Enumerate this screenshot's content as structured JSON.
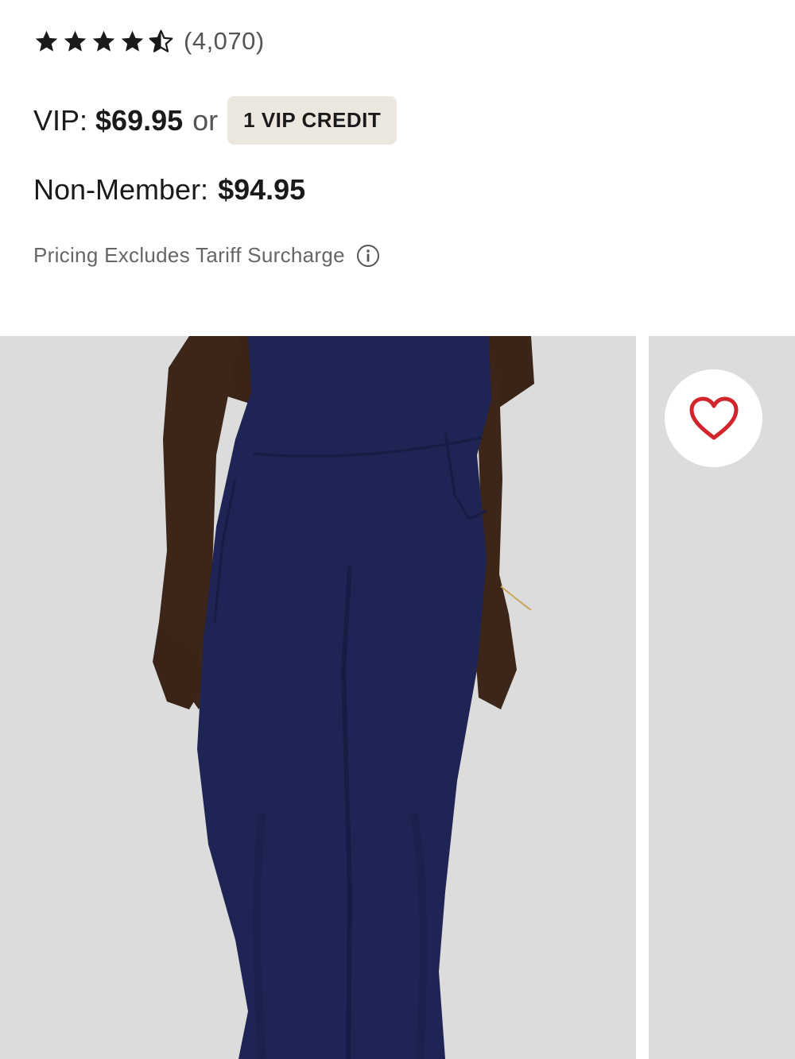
{
  "rating": {
    "stars_value": 4.5,
    "stars_max": 5,
    "review_count": "(4,070)",
    "star_color": "#1a1a1a"
  },
  "pricing": {
    "vip_label": "VIP:",
    "vip_price": "$69.95",
    "or_text": "or",
    "vip_credit_label": "1 VIP CREDIT",
    "non_member_label": "Non-Member:",
    "non_member_price": "$94.95",
    "tariff_note": "Pricing Excludes Tariff Surcharge",
    "tariff_icon": "info-icon"
  },
  "gallery": {
    "background_color": "#dcdcdc",
    "product_color": "#1e2554",
    "favorite_icon": "heart-outline-icon",
    "favorite_color": "#d0262b"
  }
}
